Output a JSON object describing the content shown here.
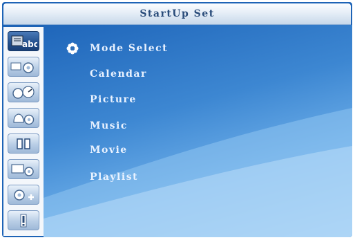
{
  "window": {
    "title": "StartUp Set"
  },
  "sidebar": {
    "items": [
      {
        "icon": "abc-text-icon",
        "label": "abc",
        "active": true
      },
      {
        "icon": "gear-settings-icon",
        "active": false
      },
      {
        "icon": "clock-gear-icon",
        "active": false
      },
      {
        "icon": "bell-gear-icon",
        "active": false
      },
      {
        "icon": "dual-slot-icon",
        "active": false
      },
      {
        "icon": "monitor-gear-icon",
        "active": false
      },
      {
        "icon": "gear-plus-icon",
        "active": false
      },
      {
        "icon": "exclamation-icon",
        "active": false
      }
    ]
  },
  "menu": {
    "selected_index": 0,
    "items": [
      {
        "label": "Mode Select"
      },
      {
        "label": "Calendar"
      },
      {
        "label": "Picture"
      },
      {
        "label": "Music"
      },
      {
        "label": "Movie"
      },
      {
        "label": "Playlist"
      }
    ]
  },
  "colors": {
    "frame": "#1d63b6",
    "menu_text": "#e9f2ff",
    "title_text": "#2a4c7a",
    "active_tab": "#234f8c"
  }
}
